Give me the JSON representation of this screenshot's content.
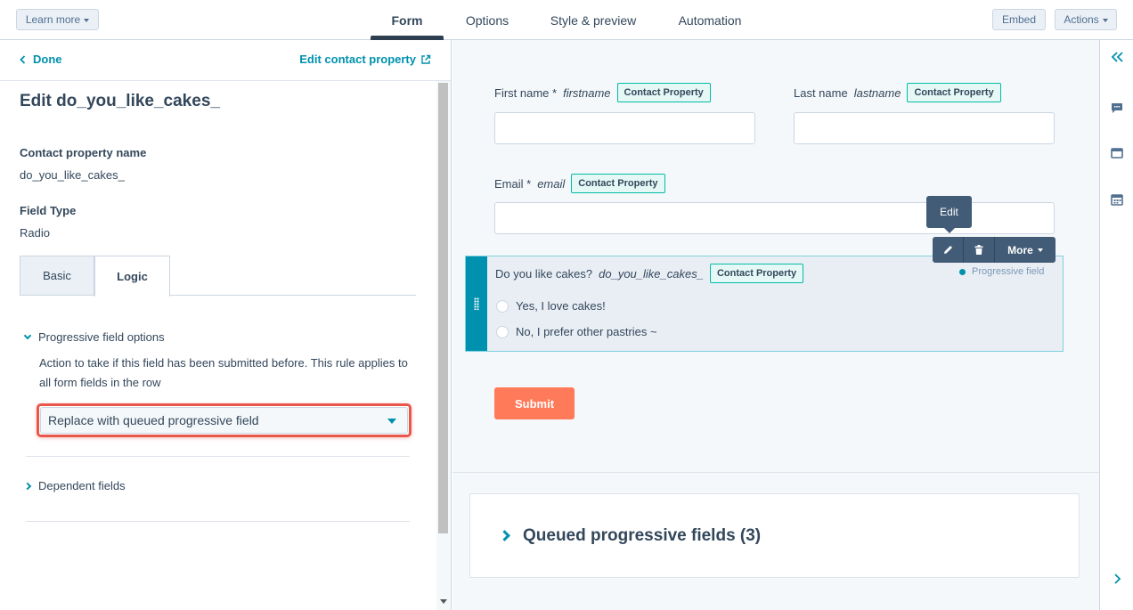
{
  "topbar": {
    "learn_more": "Learn more",
    "tabs": [
      "Form",
      "Options",
      "Style & preview",
      "Automation"
    ],
    "active_tab": "Form",
    "embed": "Embed",
    "actions": "Actions"
  },
  "left_panel": {
    "done": "Done",
    "edit_contact_property": "Edit contact property",
    "title": "Edit do_you_like_cakes_",
    "property_name_label": "Contact property name",
    "property_name_value": "do_you_like_cakes_",
    "field_type_label": "Field Type",
    "field_type_value": "Radio",
    "tabs": [
      "Basic",
      "Logic"
    ],
    "active_tab": "Logic",
    "progressive_options": {
      "heading": "Progressive field options",
      "description": "Action to take if this field has been submitted before. This rule applies to all form fields in the row",
      "selected": "Replace with queued progressive field"
    },
    "dependent_fields": "Dependent fields"
  },
  "preview": {
    "badge": "Contact Property",
    "fields": [
      {
        "label": "First name *",
        "internal": "firstname"
      },
      {
        "label": "Last name",
        "internal": "lastname"
      },
      {
        "label": "Email *",
        "internal": "email"
      }
    ],
    "tooltip": "Edit",
    "toolbar": {
      "more": "More"
    },
    "selected_field": {
      "label": "Do you like cakes?",
      "internal": "do_you_like_cakes_",
      "progressive": "Progressive field",
      "options": [
        "Yes, I love cakes!",
        "No, I prefer other pastries ~"
      ]
    },
    "submit": "Submit",
    "queued": "Queued progressive fields (3)"
  },
  "colors": {
    "accent": "#0091ae",
    "submit": "#ff7a59",
    "highlight": "#e8574a",
    "badge_border": "#00bda5"
  }
}
